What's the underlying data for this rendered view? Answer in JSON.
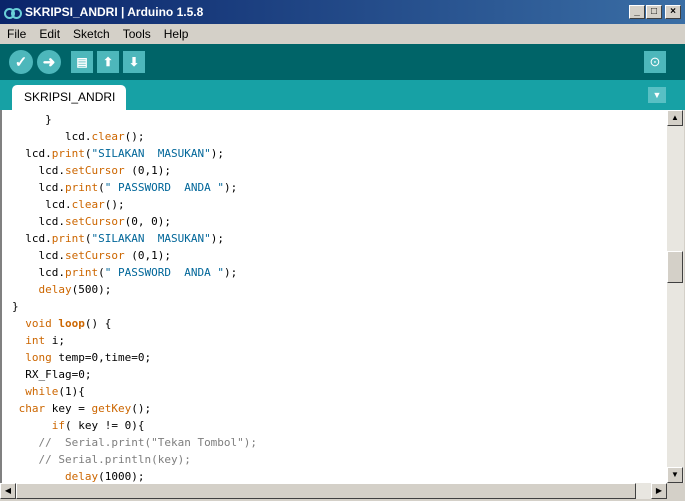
{
  "window": {
    "title": "SKRIPSI_ANDRI | Arduino 1.5.8",
    "minimize_glyph": "_",
    "maximize_glyph": "□",
    "close_glyph": "×"
  },
  "menu": [
    "File",
    "Edit",
    "Sketch",
    "Tools",
    "Help"
  ],
  "toolbar": {
    "verify_icon": "checkmark-icon",
    "upload_icon": "arrow-right-icon",
    "new_icon": "document-icon",
    "open_icon": "arrow-up-icon",
    "save_icon": "arrow-down-icon",
    "serial_monitor_icon": "magnifier-icon",
    "verify_glyph": "✓",
    "upload_glyph": "➜",
    "new_glyph": "▤",
    "open_glyph": "⬆",
    "save_glyph": "⬇",
    "monitor_glyph": "⊙"
  },
  "tabs": [
    {
      "label": "SKRIPSI_ANDRI",
      "active": true
    }
  ],
  "tab_menu_glyph": "▼",
  "scroll": {
    "up": "▲",
    "down": "▼",
    "left": "◀",
    "right": "▶"
  },
  "colors": {
    "toolbar_bg": "#006468",
    "tabs_bg": "#17a1a5",
    "button_bg": "#4db7bb",
    "keyword": "#cc6600",
    "string": "#006699",
    "comment": "#7e7e7e"
  },
  "code_lines": [
    {
      "indent": "     ",
      "tokens": [
        {
          "t": "}",
          "c": "plain"
        }
      ]
    },
    {
      "indent": "        ",
      "tokens": [
        {
          "t": "lcd.",
          "c": "plain"
        },
        {
          "t": "clear",
          "c": "fn"
        },
        {
          "t": "();",
          "c": "plain"
        }
      ]
    },
    {
      "indent": "  ",
      "tokens": [
        {
          "t": "lcd.",
          "c": "plain"
        },
        {
          "t": "print",
          "c": "fn"
        },
        {
          "t": "(",
          "c": "plain"
        },
        {
          "t": "\"SILAKAN  MASUKAN\"",
          "c": "str"
        },
        {
          "t": ");",
          "c": "plain"
        }
      ]
    },
    {
      "indent": "    ",
      "tokens": [
        {
          "t": "lcd.",
          "c": "plain"
        },
        {
          "t": "setCursor",
          "c": "fn"
        },
        {
          "t": " (0,1);",
          "c": "plain"
        }
      ]
    },
    {
      "indent": "    ",
      "tokens": [
        {
          "t": "lcd.",
          "c": "plain"
        },
        {
          "t": "print",
          "c": "fn"
        },
        {
          "t": "(",
          "c": "plain"
        },
        {
          "t": "\" PASSWORD  ANDA \"",
          "c": "str"
        },
        {
          "t": ");",
          "c": "plain"
        }
      ]
    },
    {
      "indent": "     ",
      "tokens": [
        {
          "t": "lcd.",
          "c": "plain"
        },
        {
          "t": "clear",
          "c": "fn"
        },
        {
          "t": "();",
          "c": "plain"
        }
      ]
    },
    {
      "indent": "    ",
      "tokens": [
        {
          "t": "lcd.",
          "c": "plain"
        },
        {
          "t": "setCursor",
          "c": "fn"
        },
        {
          "t": "(0, 0);",
          "c": "plain"
        }
      ]
    },
    {
      "indent": "  ",
      "tokens": [
        {
          "t": "lcd.",
          "c": "plain"
        },
        {
          "t": "print",
          "c": "fn"
        },
        {
          "t": "(",
          "c": "plain"
        },
        {
          "t": "\"SILAKAN  MASUKAN\"",
          "c": "str"
        },
        {
          "t": ");",
          "c": "plain"
        }
      ]
    },
    {
      "indent": "    ",
      "tokens": [
        {
          "t": "lcd.",
          "c": "plain"
        },
        {
          "t": "setCursor",
          "c": "fn"
        },
        {
          "t": " (0,1);",
          "c": "plain"
        }
      ]
    },
    {
      "indent": "    ",
      "tokens": [
        {
          "t": "lcd.",
          "c": "plain"
        },
        {
          "t": "print",
          "c": "fn"
        },
        {
          "t": "(",
          "c": "plain"
        },
        {
          "t": "\" PASSWORD  ANDA \"",
          "c": "str"
        },
        {
          "t": ");",
          "c": "plain"
        }
      ]
    },
    {
      "indent": "    ",
      "tokens": [
        {
          "t": "delay",
          "c": "fn"
        },
        {
          "t": "(500);",
          "c": "plain"
        }
      ]
    },
    {
      "indent": "",
      "tokens": [
        {
          "t": "}",
          "c": "plain"
        }
      ]
    },
    {
      "indent": "  ",
      "tokens": [
        {
          "t": "void",
          "c": "kw"
        },
        {
          "t": " ",
          "c": "plain"
        },
        {
          "t": "loop",
          "c": "kwb"
        },
        {
          "t": "() {",
          "c": "plain"
        }
      ]
    },
    {
      "indent": "  ",
      "tokens": [
        {
          "t": "int",
          "c": "kw"
        },
        {
          "t": " i;",
          "c": "plain"
        }
      ]
    },
    {
      "indent": "  ",
      "tokens": [
        {
          "t": "long",
          "c": "kw"
        },
        {
          "t": " temp=0,time=0;",
          "c": "plain"
        }
      ]
    },
    {
      "indent": "  ",
      "tokens": [
        {
          "t": "RX_Flag=0;",
          "c": "plain"
        }
      ]
    },
    {
      "indent": "  ",
      "tokens": [
        {
          "t": "while",
          "c": "kw"
        },
        {
          "t": "(1){",
          "c": "plain"
        }
      ]
    },
    {
      "indent": " ",
      "tokens": [
        {
          "t": "char",
          "c": "kw"
        },
        {
          "t": " key = ",
          "c": "plain"
        },
        {
          "t": "getKey",
          "c": "fn"
        },
        {
          "t": "();",
          "c": "plain"
        }
      ]
    },
    {
      "indent": "      ",
      "tokens": [
        {
          "t": "if",
          "c": "kw"
        },
        {
          "t": "( key != 0){",
          "c": "plain"
        }
      ]
    },
    {
      "indent": "    ",
      "tokens": [
        {
          "t": "//  Serial.print(\"Tekan Tombol\");",
          "c": "cmt"
        }
      ]
    },
    {
      "indent": "    ",
      "tokens": [
        {
          "t": "// Serial.println(key);",
          "c": "cmt"
        }
      ]
    },
    {
      "indent": "        ",
      "tokens": [
        {
          "t": "delay",
          "c": "fn"
        },
        {
          "t": "(1000);",
          "c": "plain"
        }
      ]
    }
  ]
}
